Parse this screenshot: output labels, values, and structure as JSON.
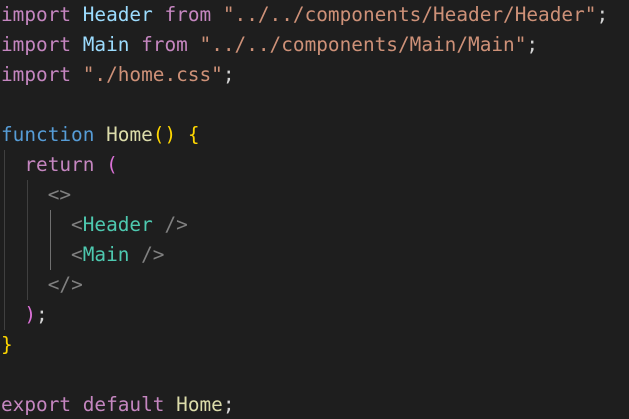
{
  "colors": {
    "background": "#1e1e1e",
    "keyword_control": "#c586c0",
    "keyword": "#569cd6",
    "variable": "#9cdcfe",
    "string": "#ce9178",
    "function": "#dcdcaa",
    "component_tag": "#4ec9b0",
    "tag_punctuation": "#808080",
    "bracket_level1": "#ffd700",
    "bracket_level2": "#da70d6"
  },
  "code": {
    "line1": {
      "kw": "import",
      "id": "Header",
      "from": "from",
      "path": "\"../../components/Header/Header\"",
      "semi": ";"
    },
    "line2": {
      "kw": "import",
      "id": "Main",
      "from": "from",
      "path": "\"../../components/Main/Main\"",
      "semi": ";"
    },
    "line3": {
      "kw": "import",
      "path": "\"./home.css\"",
      "semi": ";"
    },
    "line5": {
      "kw": "function",
      "name": "Home",
      "parens": "()",
      "brace": "{"
    },
    "line6": {
      "kw": "return",
      "paren": "("
    },
    "line7": {
      "open": "<",
      "close": ">"
    },
    "line8": {
      "open": "<",
      "tag": "Header",
      "close": " />"
    },
    "line9": {
      "open": "<",
      "tag": "Main",
      "close": " />"
    },
    "line10": {
      "open": "</",
      "close": ">"
    },
    "line11": {
      "paren": ")",
      "semi": ";"
    },
    "line12": {
      "brace": "}"
    },
    "line14": {
      "kw1": "export",
      "kw2": "default",
      "name": "Home",
      "semi": ";"
    }
  }
}
